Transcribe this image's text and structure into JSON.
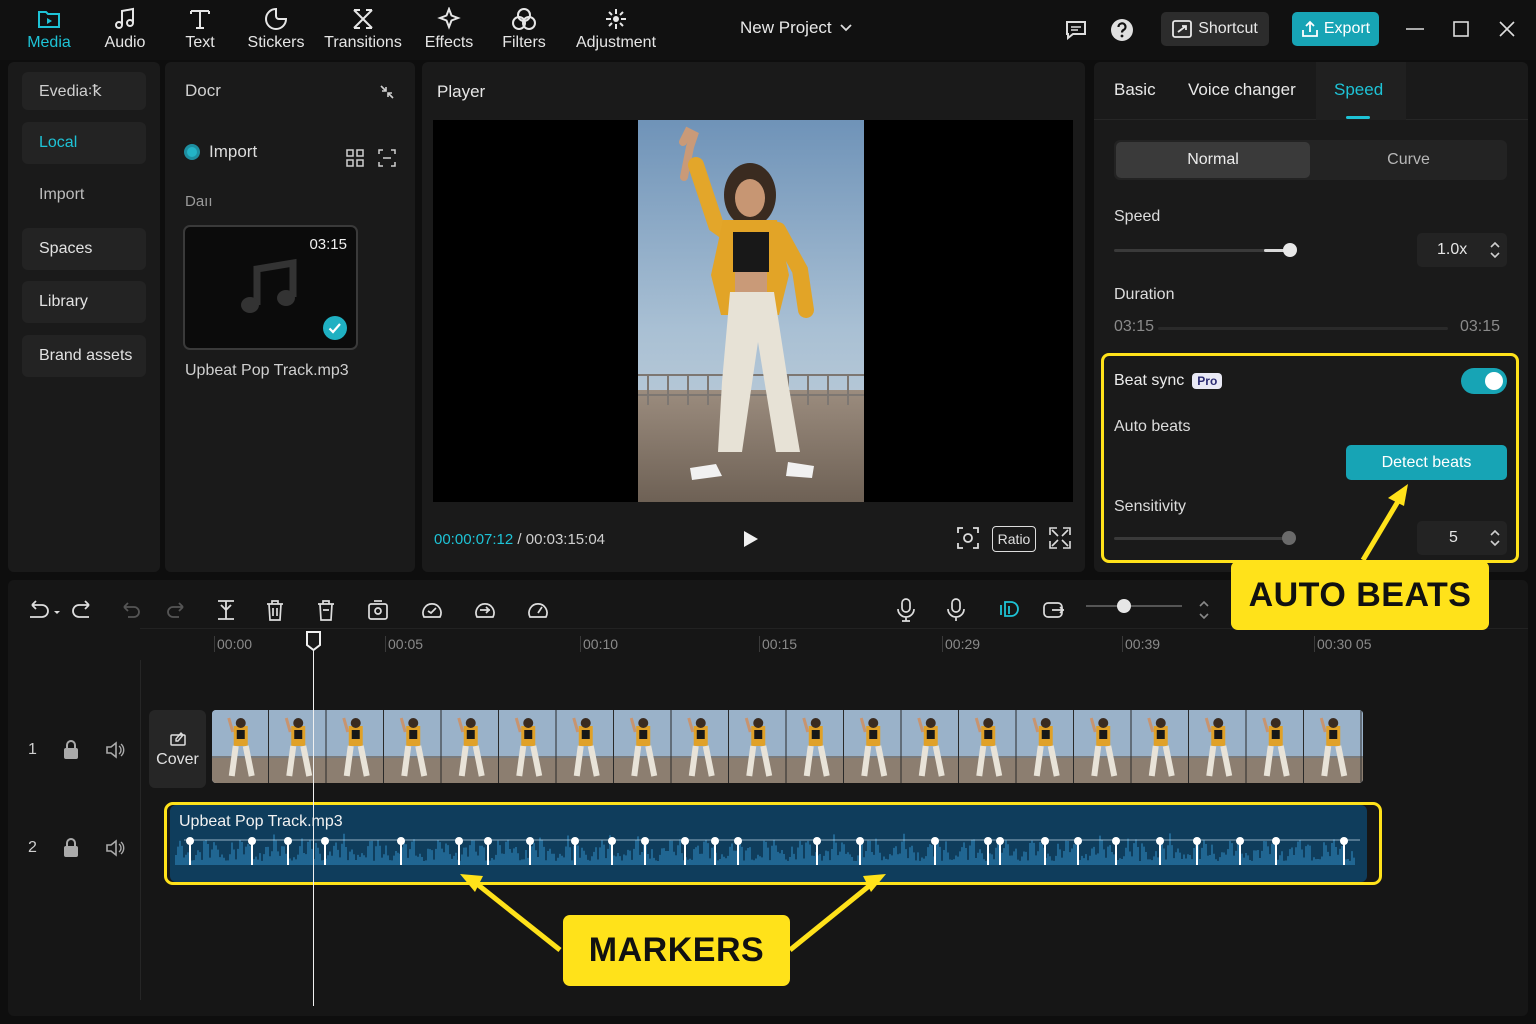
{
  "topbar": {
    "tools": [
      {
        "label": "Media",
        "icon": "media-folder-icon",
        "active": true
      },
      {
        "label": "Audio",
        "icon": "music-note-icon",
        "active": false
      },
      {
        "label": "Text",
        "icon": "text-t-icon",
        "active": false
      },
      {
        "label": "Stickers",
        "icon": "sticker-icon",
        "active": false
      },
      {
        "label": "Transitions",
        "icon": "transitions-icon",
        "active": false
      },
      {
        "label": "Effects",
        "icon": "sparkle-effects-icon",
        "active": false
      },
      {
        "label": "Filters",
        "icon": "filters-circles-icon",
        "active": false
      },
      {
        "label": "Adjustment",
        "icon": "adjustment-icon",
        "active": false
      }
    ],
    "project_title": "New Project",
    "shortcut_label": "Shortcut",
    "export_label": "Export",
    "accent_color": "#1ec3d6",
    "export_color": "#17a4b5"
  },
  "left_nav": {
    "header": "Εvedia꞉ꝁ",
    "items": [
      {
        "label": "Local",
        "selected": true
      },
      {
        "label": "Import",
        "selected": false
      },
      {
        "label": "Spaces",
        "selected": false
      },
      {
        "label": "Library",
        "selected": false
      },
      {
        "label": "Brand assets",
        "selected": false
      }
    ]
  },
  "media_panel": {
    "header": "Docr",
    "import_label": "Import",
    "section_label": "Daıı",
    "item": {
      "duration": "03:15",
      "name": "Upbeat Pop Track.mp3"
    }
  },
  "player": {
    "title": "Player",
    "current_time": "00:00:07:12",
    "total_time": "/ 00:03:15:04",
    "ratio_label": "Ratio"
  },
  "right_panel": {
    "tabs": [
      {
        "label": "Basic",
        "active": false
      },
      {
        "label": "Voice changer",
        "active": false
      },
      {
        "label": "Speed",
        "active": true
      }
    ],
    "modes": [
      {
        "label": "Normal",
        "active": true
      },
      {
        "label": "Curve",
        "active": false
      }
    ],
    "speed_label": "Speed",
    "speed_value": "1.0x",
    "speed_slider_fraction": 0.98,
    "duration_label": "Duration",
    "duration_start": "03:15",
    "duration_end": "03:15",
    "beat_sync_label": "Beat sync",
    "pro_badge": "Pro",
    "beat_sync_on": true,
    "auto_beats_label": "Auto beats",
    "detect_beats_label": "Detect beats",
    "sensitivity_label": "Sensitivity",
    "sensitivity_value": "5",
    "sensitivity_slider_fraction": 0.97
  },
  "callouts": {
    "auto_beats": "AUTO BEATS",
    "markers": "MARKERS",
    "highlight_color": "#ffe21a"
  },
  "timeline": {
    "ruler": [
      "00:00",
      "00:05",
      "00:10",
      "00:15",
      "00:29",
      "00:39",
      "00:30 05"
    ],
    "zoom_fraction": 0.4,
    "tracks": [
      {
        "num": "1",
        "cover_label": "Cover"
      },
      {
        "num": "2",
        "audio_name": "Upbeat Pop Track.mp3"
      }
    ]
  }
}
